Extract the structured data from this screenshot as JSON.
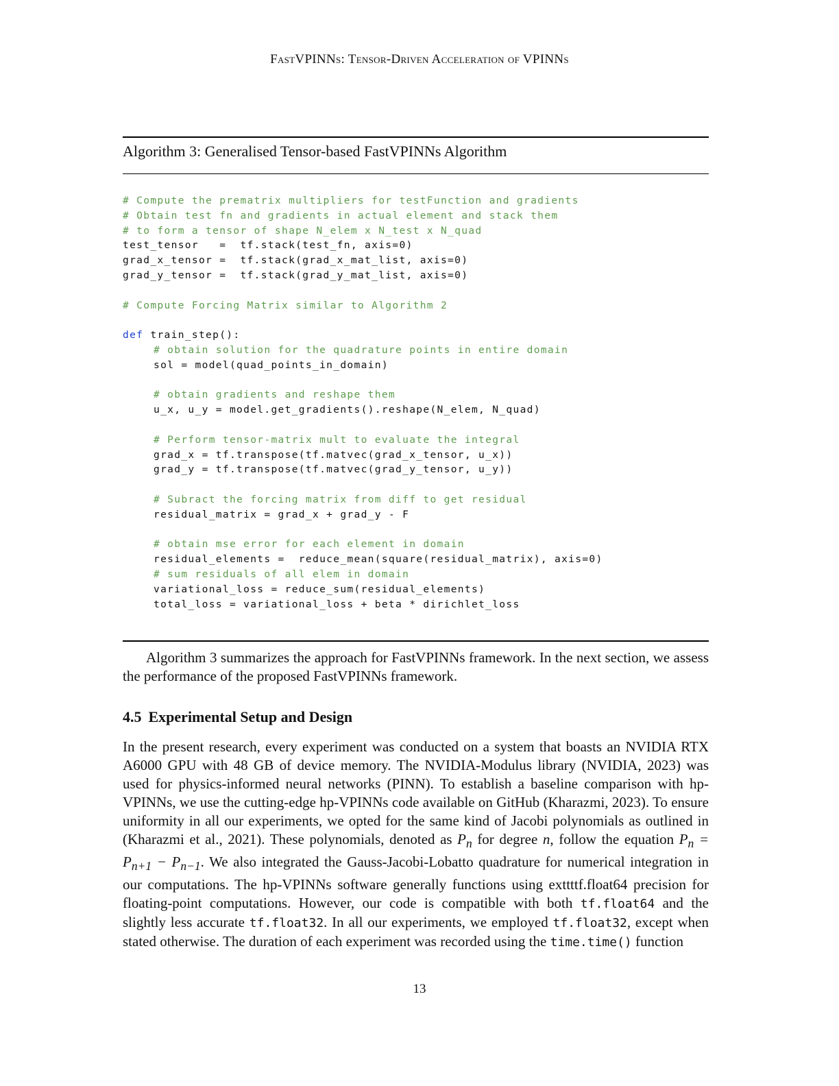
{
  "running_head": "FastVPINNs: Tensor-Driven Acceleration of VPINNs",
  "algorithm": {
    "caption": "Algorithm 3: Generalised Tensor-based FastVPINNs Algorithm",
    "lines": {
      "l1": "# Compute the prematrix multipliers for testFunction and gradients",
      "l2": "# Obtain test fn and gradients in actual element and stack them",
      "l3": "# to form a tensor of shape N_elem x N_test x N_quad",
      "l4": "test_tensor   =  tf.stack(test_fn, axis=0)",
      "l5": "grad_x_tensor =  tf.stack(grad_x_mat_list, axis=0)",
      "l6": "grad_y_tensor =  tf.stack(grad_y_mat_list, axis=0)",
      "l7": "# Compute Forcing Matrix similar to Algorithm 2",
      "l8_kw": "def",
      "l8_rest": " train_step():",
      "l9": "# obtain solution for the quadrature points in entire domain",
      "l10": "sol = model(quad_points_in_domain)",
      "l11": "# obtain gradients and reshape them",
      "l12": "u_x, u_y = model.get_gradients().reshape(N_elem, N_quad)",
      "l13": "# Perform tensor-matrix mult to evaluate the integral",
      "l14": "grad_x = tf.transpose(tf.matvec(grad_x_tensor, u_x))",
      "l15": "grad_y = tf.transpose(tf.matvec(grad_y_tensor, u_y))",
      "l16": "# Subract the forcing matrix from diff to get residual",
      "l17": "residual_matrix = grad_x + grad_y - F",
      "l18": "# obtain mse error for each element in domain",
      "l19": "residual_elements =  reduce_mean(square(residual_matrix), axis=0)",
      "l20": "# sum residuals of all elem in domain",
      "l21": "variational_loss = reduce_sum(residual_elements)",
      "l22": "total_loss = variational_loss + beta * dirichlet_loss"
    }
  },
  "paragraph_algo": "Algorithm 3 summarizes the approach for FastVPINNs framework. In the next section, we assess the performance of the proposed FastVPINNs framework.",
  "section": {
    "number": "4.5",
    "title": "Experimental Setup and Design"
  },
  "paragraph_setup": {
    "p1": "In the present research, every experiment was conducted on a system that boasts an NVIDIA RTX A6000 GPU with 48 GB of device memory. The NVIDIA-Modulus library (NVIDIA, 2023) was used for physics-informed neural networks (PINN). To establish a baseline comparison with hp-VPINNs, we use the cutting-edge hp-VPINNs code available on GitHub (Kharazmi, 2023). To ensure uniformity in all our experiments, we opted for the same kind of Jacobi polynomials as outlined in (Kharazmi et al., 2021). These polynomials, denoted as ",
    "m1": "P",
    "m1_sub": "n",
    "p2": " for degree ",
    "m2": "n",
    "p3": ", follow the equation ",
    "eq": "P",
    "eq_sub": "n",
    "eq_mid": " = P",
    "eq_sub2": "n+1",
    "eq_mid2": " − P",
    "eq_sub3": "n−1",
    "p4": ". We also integrated the Gauss-Jacobi-Lobatto quadrature for numerical integration in our computations. The hp-VPINNs software generally functions using exttttf.float64 precision for floating-point computations. However, our code is compatible with both ",
    "t1": "tf.float64",
    "p5": " and the slightly less accurate ",
    "t2": "tf.float32",
    "p6": ". In all our experiments, we employed ",
    "t3": "tf.float32",
    "p7": ", except when stated otherwise. The duration of each experiment was recorded using the ",
    "t4": "time.time()",
    "p8": " function"
  },
  "page_number": "13"
}
